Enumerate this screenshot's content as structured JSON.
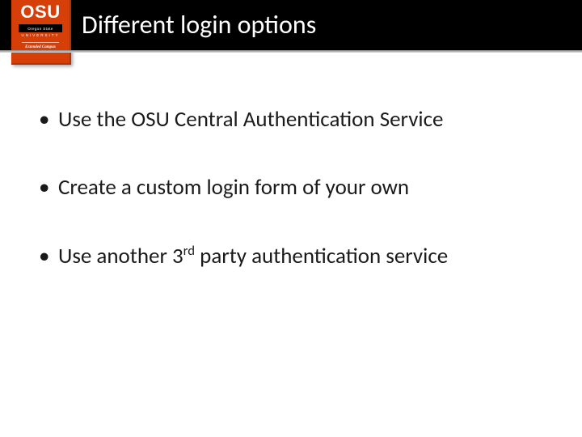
{
  "logo": {
    "short": "OSU",
    "line1": "Oregon State",
    "line2": "UNIVERSITY",
    "sub": "Extended Campus"
  },
  "title": "Different login options",
  "bullets": [
    {
      "text": "Use the OSU Central Authentication Service"
    },
    {
      "prefix": "Use another 3",
      "sup": "rd",
      "suffix": " party authentication service",
      "text": "Create a custom login form of your own"
    }
  ],
  "items": {
    "b1": "Use the OSU Central Authentication Service",
    "b2": "Create a custom login form of your own",
    "b3_prefix": "Use another 3",
    "b3_sup": "rd",
    "b3_suffix": " party authentication service"
  }
}
